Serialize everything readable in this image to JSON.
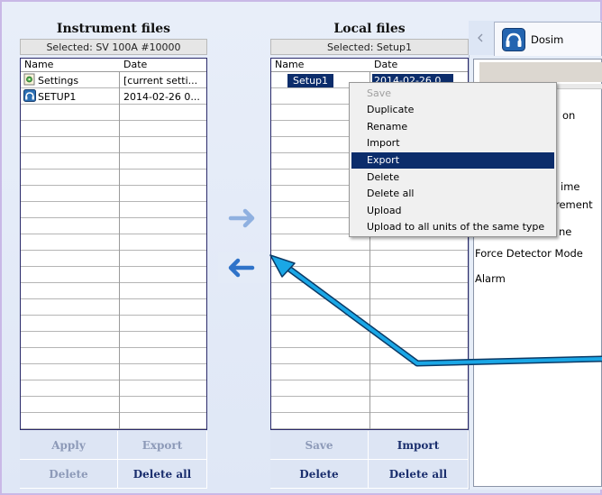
{
  "instrument": {
    "title": "Instrument files",
    "selected": "Selected: SV 100A #10000",
    "col_name": "Name",
    "col_date": "Date",
    "rows": [
      {
        "name": "Settings",
        "date": "[current setti...",
        "icon": "settings-file-icon"
      },
      {
        "name": "SETUP1",
        "date": "2014-02-26 0...",
        "icon": "setup-file-icon"
      }
    ],
    "buttons": {
      "apply": "Apply",
      "export": "Export",
      "delete": "Delete",
      "delete_all": "Delete all"
    }
  },
  "local": {
    "title": "Local files",
    "selected": "Selected: Setup1",
    "col_name": "Name",
    "col_date": "Date",
    "rows": [
      {
        "name": "Setup1",
        "date": "2014-02-26 0..."
      }
    ],
    "buttons": {
      "save": "Save",
      "import": "Import",
      "delete": "Delete",
      "delete_all": "Delete all"
    }
  },
  "transfer": {
    "to_local_icon": "arrow-right-icon",
    "to_instrument_icon": "arrow-left-icon"
  },
  "context_menu": {
    "items": [
      {
        "label": "Save",
        "state": "disabled"
      },
      {
        "label": "Duplicate",
        "state": "normal"
      },
      {
        "label": "Rename",
        "state": "normal"
      },
      {
        "label": "Import",
        "state": "normal"
      },
      {
        "label": "Export",
        "state": "highlighted"
      },
      {
        "label": "Delete",
        "state": "normal"
      },
      {
        "label": "Delete all",
        "state": "normal"
      },
      {
        "label": "Upload",
        "state": "normal"
      },
      {
        "label": "Upload to all units of the same type",
        "state": "normal"
      }
    ]
  },
  "right_panel": {
    "tab_label": "Dosim",
    "tab_icon": "headphones-icon",
    "scroll_left_icon": "chevron-left-icon",
    "settings": [
      {
        "text": "on"
      },
      {
        "text": "ime"
      },
      {
        "text": "rement"
      },
      {
        "text": "ne"
      },
      {
        "text": "Force Detector Mode"
      },
      {
        "text": "Alarm"
      }
    ]
  },
  "colors": {
    "accent_annotation": "#1aa7e6",
    "highlight": "#0c2d6b",
    "button_text": "#1b2f6e",
    "list_border": "#2a2a6a"
  }
}
